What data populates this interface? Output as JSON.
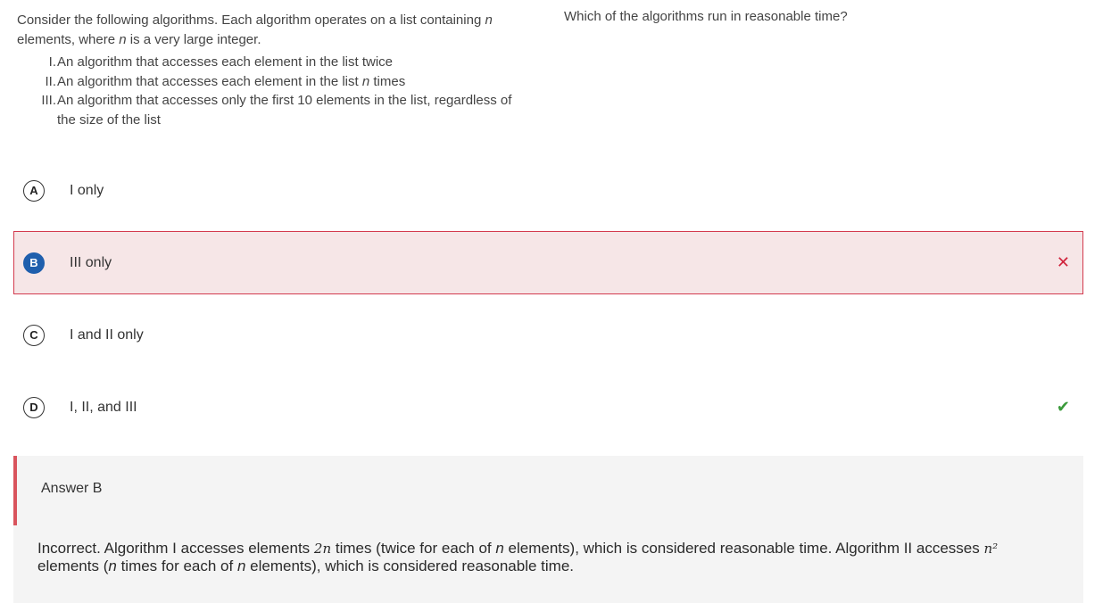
{
  "stimulus": {
    "intro_1": "Consider the following algorithms. Each algorithm operates on a list containing ",
    "var_n": "n",
    "intro_2": " elements, where ",
    "intro_3": " is a very large integer.",
    "items": [
      {
        "num": "I.",
        "text": "An algorithm that accesses each element in the list twice"
      },
      {
        "num": "II.",
        "text_1": "An algorithm that accesses each element in the list ",
        "var": "n",
        "text_2": " times"
      },
      {
        "num": "III.",
        "text": "An algorithm that accesses only the first 10 elements in the list, regardless of the size of the list"
      }
    ]
  },
  "question": {
    "stem": "Which of the algorithms run in reasonable time?"
  },
  "choices": [
    {
      "letter": "A",
      "label": "I only",
      "state": "none",
      "mark": ""
    },
    {
      "letter": "B",
      "label": "III only",
      "state": "selected-incorrect",
      "mark": "✕"
    },
    {
      "letter": "C",
      "label": "I and II only",
      "state": "none",
      "mark": ""
    },
    {
      "letter": "D",
      "label": "I, II, and III",
      "state": "correct",
      "mark": "✔"
    }
  ],
  "explanation": {
    "answer_label": "Answer B",
    "rationale": {
      "p1": "Incorrect. Algorithm I accesses elements ",
      "math_2n": "2n",
      "p2": " times (twice for each of ",
      "var_n": "n",
      "p3": " elements), which is considered reasonable time. Algorithm II accesses ",
      "math_n2": "n²",
      "p4": " elements (",
      "p5": " times for each of ",
      "p6": " elements), which is considered reasonable time."
    }
  },
  "colors": {
    "incorrect_bg": "#f6e6e7",
    "incorrect_border": "#d33a4e",
    "selected_badge": "#1f5fad",
    "wrong_mark": "#d0243c",
    "right_mark": "#3a9a3a",
    "explain_bar": "#d9545d"
  }
}
